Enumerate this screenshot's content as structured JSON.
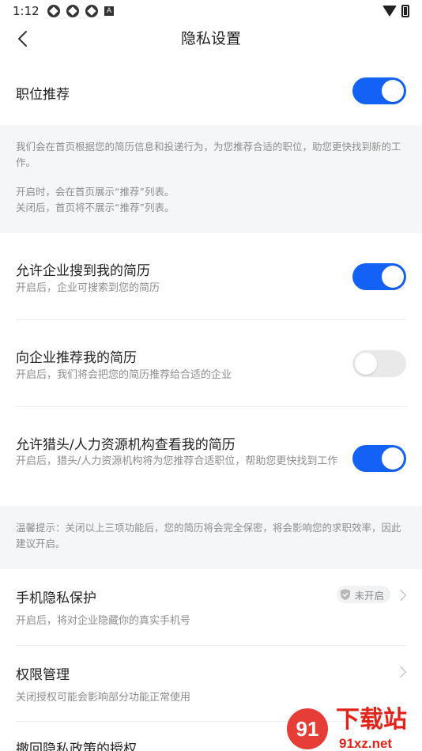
{
  "status_bar": {
    "time": "1:12",
    "a_label": "A"
  },
  "nav": {
    "title": "隐私设置"
  },
  "job_recommend": {
    "title": "职位推荐",
    "toggle_on": true,
    "desc_1": "我们会在首页根据您的简历信息和投递行为，为您推荐合适的职位，助您更快找到新的工作。",
    "desc_2": "开启时，会在首页展示“推荐”列表。",
    "desc_3": "关闭后，首页将不展示“推荐”列表。"
  },
  "settings": [
    {
      "title": "允许企业搜到我的简历",
      "subtitle": "开启后，企业可搜索到您的简历",
      "toggle_on": true
    },
    {
      "title": "向企业推荐我的简历",
      "subtitle": "开启后，我们将会把您的简历推荐给合适的企业",
      "toggle_on": false
    },
    {
      "title": "允许猎头/人力资源机构查看我的简历",
      "subtitle": "开启后，猎头/人力资源机构将为您推荐合适职位，帮助您更快找到工作",
      "toggle_on": true
    }
  ],
  "tip": {
    "text": "温馨提示：关闭以上三项功能后，您的简历将会完全保密，将会影响您的求职效率，因此建议开启。"
  },
  "phone_privacy": {
    "title": "手机隐私保护",
    "subtitle": "开启后，将对企业隐藏你的真实手机号",
    "badge": "未开启"
  },
  "permission": {
    "title": "权限管理",
    "subtitle": "关闭授权可能会影响部分功能正常使用"
  },
  "revoke": {
    "title": "撤回隐私政策的授权"
  },
  "watermark": {
    "brand": "下载站",
    "domain": "91xz.net",
    "logo_glyph": "91"
  },
  "colors": {
    "accent": "#1462f5",
    "toggle_off": "#e9e9e9",
    "gray_bg": "#f5f6f8",
    "watermark": "#e2231a"
  }
}
